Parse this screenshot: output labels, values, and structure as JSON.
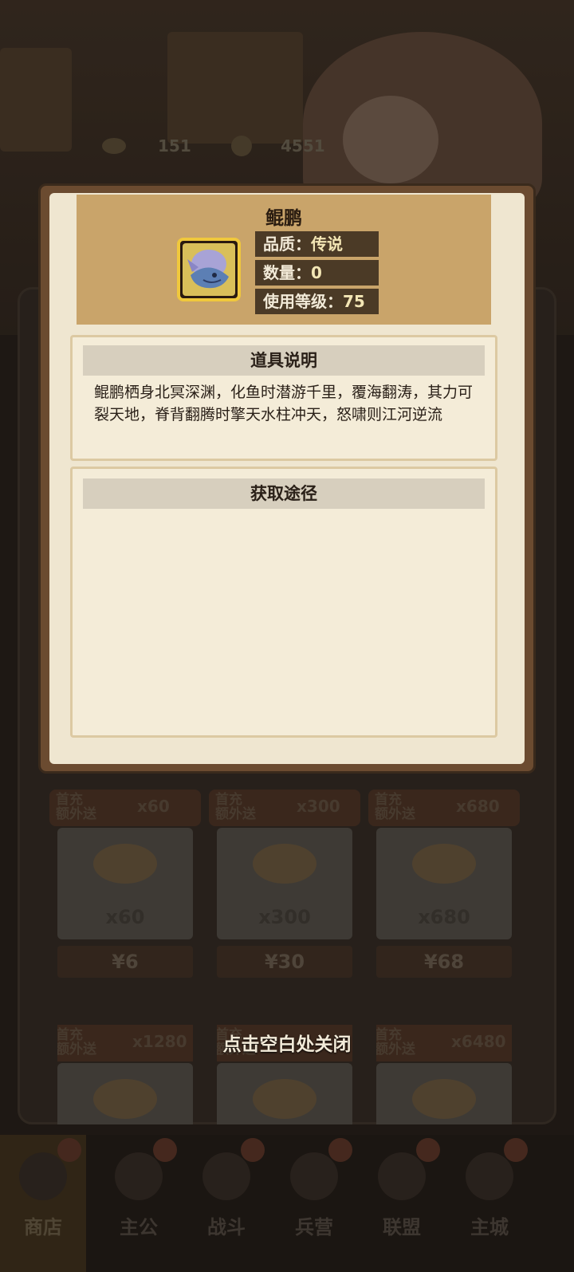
{
  "background": {
    "currency": [
      {
        "icon": "ingot-icon",
        "value": "151"
      },
      {
        "icon": "coin-icon",
        "value": "4551"
      }
    ],
    "shop_cards": [
      {
        "tag_line1": "首充",
        "tag_line2": "额外送",
        "bonus": "x60",
        "amount": "x60",
        "price": "¥6"
      },
      {
        "tag_line1": "首充",
        "tag_line2": "额外送",
        "bonus": "x300",
        "amount": "x300",
        "price": "¥30"
      },
      {
        "tag_line1": "首充",
        "tag_line2": "额外送",
        "bonus": "x680",
        "amount": "x680",
        "price": "¥68"
      },
      {
        "tag_line1": "首充",
        "tag_line2": "额外送",
        "bonus": "x1280",
        "amount": "",
        "price": ""
      },
      {
        "tag_line1": "首充",
        "tag_line2": "额外送",
        "bonus": "",
        "amount": "",
        "price": ""
      },
      {
        "tag_line1": "首充",
        "tag_line2": "额外送",
        "bonus": "x6480",
        "amount": "",
        "price": ""
      }
    ],
    "nav": [
      {
        "label": "商店",
        "icon": "shop-icon",
        "active": true
      },
      {
        "label": "主公",
        "icon": "lord-icon",
        "active": false
      },
      {
        "label": "战斗",
        "icon": "battle-icon",
        "active": false
      },
      {
        "label": "兵营",
        "icon": "barracks-icon",
        "active": false
      },
      {
        "label": "联盟",
        "icon": "alliance-icon",
        "active": false
      },
      {
        "label": "主城",
        "icon": "city-icon",
        "active": false
      }
    ]
  },
  "item": {
    "name": "鲲鹏",
    "icon": "kunpeng-icon",
    "quality_label": "品质：",
    "quality_value": "传说",
    "count_label": "数量：",
    "count_value": "0",
    "level_label": "使用等级：",
    "level_value": "75"
  },
  "description": {
    "title": "道具说明",
    "text": "鲲鹏栖身北冥深渊，化鱼时潜游千里，覆海翻涛，其力可裂天地，脊背翻腾时擎天水柱冲天，怒啸则江河逆流"
  },
  "source": {
    "title": "获取途径"
  },
  "close_hint": "点击空白处关闭",
  "colors": {
    "panel_gold": "#c9a46a",
    "paper": "#efe6d0",
    "stat_bg": "#4b3a26",
    "frame_border": "#f0c83c"
  }
}
